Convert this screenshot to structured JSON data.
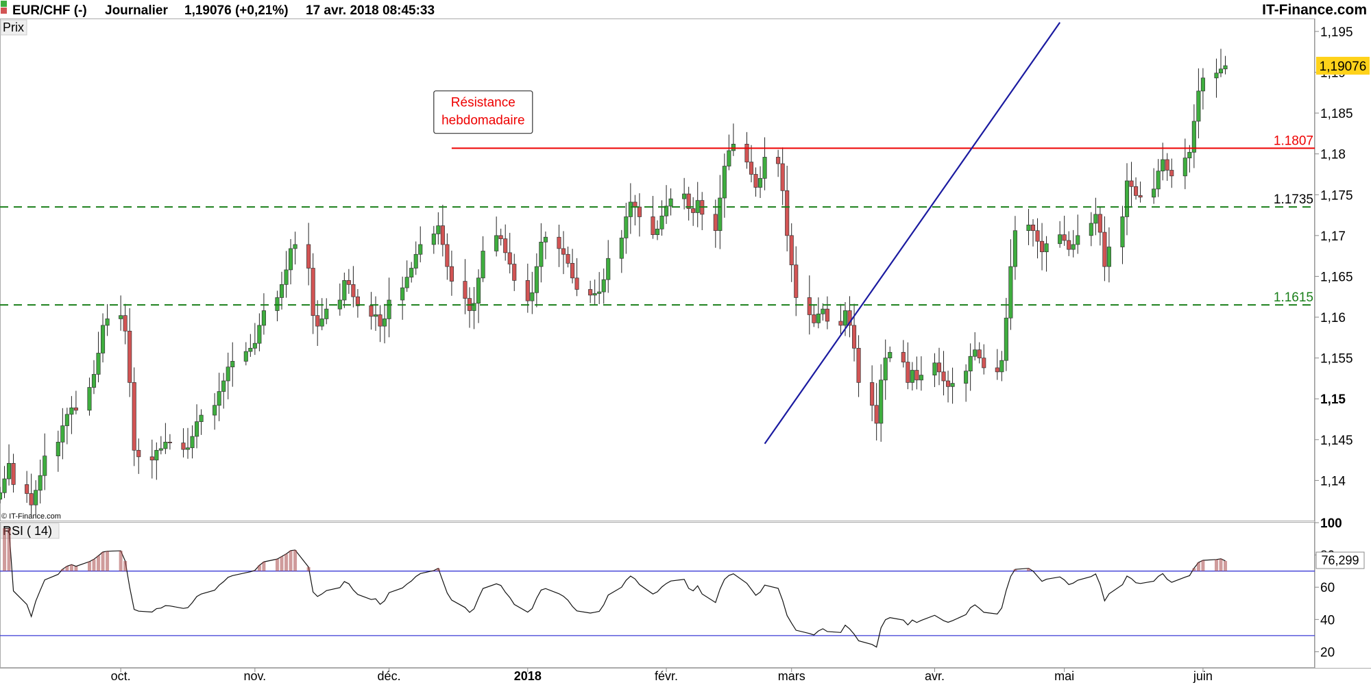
{
  "header": {
    "symbol": "EUR/CHF (-)",
    "period": "Journalier",
    "quote": "1,19076 (+0,21%)",
    "datetime": "17 avr. 2018 08:45:33",
    "brand": "IT-Finance.com"
  },
  "price_panel": {
    "label": "Prix",
    "copyright": "© IT-Finance.com"
  },
  "rsi_panel": {
    "label": "RSI ( 14)",
    "current": "76,299"
  },
  "colors": {
    "up": "#3fae3f",
    "down": "#d25454",
    "resistance": "#ee0000",
    "support": "#1a7f1a",
    "trendline": "#1a1aa0",
    "rsi_band": "#3a3ad6",
    "last_price_bg": "#ffd21a"
  },
  "chart_data": [
    {
      "type": "candlestick",
      "title": "EUR/CHF (-) Journalier",
      "ylim": [
        1.135,
        1.1965
      ],
      "y_ticks": [
        "1,195",
        "1,19",
        "1,185",
        "1,18",
        "1,175",
        "1,17",
        "1,165",
        "1,16",
        "1,155",
        "1,15",
        "1,145",
        "1,14"
      ],
      "y_tick_values": [
        1.195,
        1.19,
        1.185,
        1.18,
        1.175,
        1.17,
        1.165,
        1.16,
        1.155,
        1.15,
        1.145,
        1.14
      ],
      "x_ticks": [
        {
          "label": "oct.",
          "date": "2017-10-02"
        },
        {
          "label": "nov.",
          "date": "2017-11-01"
        },
        {
          "label": "déc.",
          "date": "2017-12-01"
        },
        {
          "label": "2018",
          "date": "2018-01-01",
          "bold": true
        },
        {
          "label": "févr.",
          "date": "2018-02-01"
        },
        {
          "label": "mars",
          "date": "2018-03-01"
        },
        {
          "label": "avr.",
          "date": "2018-04-02"
        },
        {
          "label": "mai",
          "date": "2018-05-01"
        },
        {
          "label": "juin",
          "date": "2018-06-01"
        }
      ],
      "date_range": [
        "2017-09-05",
        "2018-06-26"
      ],
      "close_series": {
        "start_date": "2017-09-05",
        "end_date": "2018-04-17",
        "values": [
          1.1385,
          1.1402,
          1.1421,
          1.1395,
          1.1384,
          1.137,
          1.1388,
          1.1406,
          1.143,
          1.1447,
          1.1467,
          1.1481,
          1.1489,
          1.1486,
          1.1514,
          1.153,
          1.1556,
          1.159,
          1.1598,
          1.1602,
          1.1583,
          1.152,
          1.1437,
          1.1429,
          1.1425,
          1.1437,
          1.1439,
          1.1447,
          1.1446,
          1.1438,
          1.144,
          1.1454,
          1.1472,
          1.148,
          1.1492,
          1.1509,
          1.1522,
          1.1539,
          1.1546,
          1.1558,
          1.1562,
          1.1568,
          1.159,
          1.1608,
          1.1624,
          1.164,
          1.1658,
          1.1684,
          1.1689,
          1.166,
          1.1602,
          1.1589,
          1.1598,
          1.161,
          1.1621,
          1.1645,
          1.164,
          1.1625,
          1.1614,
          1.1601,
          1.1603,
          1.1589,
          1.1598,
          1.1621,
          1.1636,
          1.1649,
          1.166,
          1.1677,
          1.1689,
          1.1702,
          1.1712,
          1.1689,
          1.1662,
          1.1644,
          1.1623,
          1.1608,
          1.1617,
          1.1648,
          1.1681,
          1.17,
          1.1696,
          1.1679,
          1.1665,
          1.1645,
          1.162,
          1.163,
          1.1662,
          1.1692,
          1.1698,
          1.1684,
          1.1677,
          1.1666,
          1.1648,
          1.1634,
          1.1627,
          1.1629,
          1.1631,
          1.1646,
          1.1672,
          1.1697,
          1.1723,
          1.1741,
          1.1735,
          1.1723,
          1.1701,
          1.1708,
          1.1724,
          1.1736,
          1.1745,
          1.1751,
          1.1733,
          1.1728,
          1.1743,
          1.1726,
          1.1706,
          1.1746,
          1.1785,
          1.1804,
          1.1812,
          1.179,
          1.1775,
          1.1759,
          1.177,
          1.1796,
          1.1788,
          1.1755,
          1.17,
          1.1664,
          1.1624,
          1.1603,
          1.1593,
          1.1604,
          1.161,
          1.1595,
          1.159,
          1.1608,
          1.159,
          1.1562,
          1.152,
          1.1492,
          1.147,
          1.1523,
          1.155,
          1.1557,
          1.1545,
          1.152,
          1.1535,
          1.1523,
          1.1529,
          1.1544,
          1.1533,
          1.1522,
          1.1515,
          1.1519,
          1.1534,
          1.1552,
          1.156,
          1.155,
          1.1538,
          1.1533,
          1.1547,
          1.1599,
          1.1662,
          1.1706,
          1.1713,
          1.1706,
          1.1693,
          1.168,
          1.169,
          1.1701,
          1.1694,
          1.1683,
          1.1689,
          1.17,
          1.1715,
          1.1726,
          1.1704,
          1.1662,
          1.1686,
          1.1723,
          1.1767,
          1.176,
          1.1749,
          1.1747,
          1.1757,
          1.1779,
          1.1793,
          1.178,
          1.1773,
          1.1795,
          1.1802,
          1.184,
          1.1877,
          1.1893,
          1.1899,
          1.1904,
          1.1908
        ]
      },
      "last_price": "1,19076",
      "levels": [
        {
          "name": "Résistance hebdomadaire",
          "label": "1.1807",
          "value": 1.1807,
          "style": "solid",
          "start_date": "2017-12-15"
        },
        {
          "label": "1.1735",
          "value": 1.1735,
          "style": "dashed"
        },
        {
          "label": "1.1615",
          "value": 1.1615,
          "style": "dashed"
        }
      ],
      "annotations": [
        {
          "text": [
            "Résistance",
            "hebdomadaire"
          ],
          "anchor_date": "2017-12-11",
          "anchor_value": 1.1852
        }
      ],
      "trendline": {
        "start": {
          "date": "2018-02-23",
          "value": 1.1445
        },
        "end": {
          "date": "2018-04-30",
          "value": 1.1961
        }
      }
    },
    {
      "type": "line",
      "title": "RSI ( 14)",
      "ylim": [
        10,
        100
      ],
      "y_ticks": [
        "100",
        "80",
        "60",
        "40",
        "20"
      ],
      "y_tick_values": [
        100,
        80,
        60,
        40,
        20
      ],
      "bands": [
        70,
        30
      ],
      "current": 76.3,
      "series": [
        {
          "name": "RSI ( 14)",
          "values": []
        }
      ]
    }
  ]
}
